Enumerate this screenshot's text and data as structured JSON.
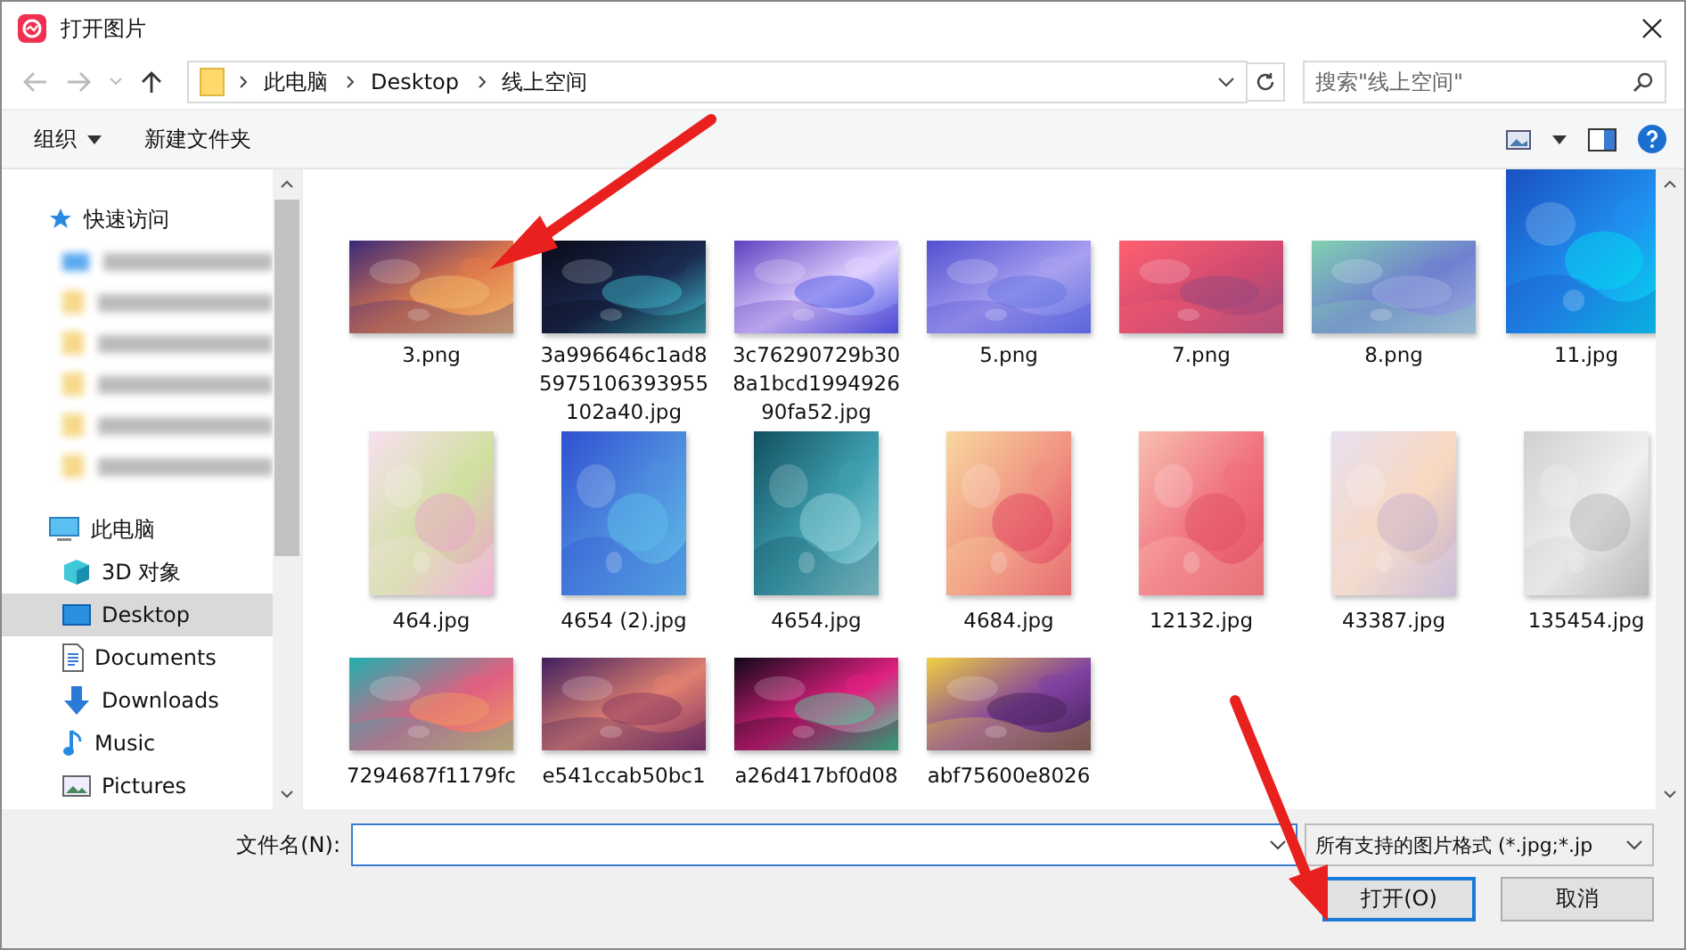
{
  "window": {
    "title": "打开图片"
  },
  "address": {
    "path": [
      "此电脑",
      "Desktop",
      "线上空间"
    ]
  },
  "search": {
    "placeholder": "搜索\"线上空间\""
  },
  "toolbar": {
    "buttons": [
      "组织",
      "新建文件夹"
    ]
  },
  "sidebar": {
    "quick_access": "快速访问",
    "items": [
      {
        "label": "此电脑",
        "kind": "pc",
        "selected": false,
        "children": [
          {
            "label": "3D 对象",
            "kind": "cube",
            "selected": false
          },
          {
            "label": "Desktop",
            "kind": "desktop",
            "selected": true
          },
          {
            "label": "Documents",
            "kind": "doc",
            "selected": false
          },
          {
            "label": "Downloads",
            "kind": "download",
            "selected": false
          },
          {
            "label": "Music",
            "kind": "music",
            "selected": false
          },
          {
            "label": "Pictures",
            "kind": "pictures",
            "selected": false
          }
        ]
      }
    ]
  },
  "files": [
    {
      "name": "3.png",
      "kind": "picture"
    },
    {
      "name": "3a996646c1ad85975106393955102a40.jpg",
      "kind": "picture"
    },
    {
      "name": "3c76290729b308a1bcd199492690fa52.jpg",
      "kind": "picture"
    },
    {
      "name": "5.png",
      "kind": "picture"
    },
    {
      "name": "7.png",
      "kind": "picture"
    },
    {
      "name": "8.png",
      "kind": "picture"
    },
    {
      "name": "11.jpg",
      "kind": "picture"
    },
    {
      "name": "464.jpg",
      "kind": "picture"
    },
    {
      "name": "4654 (2).jpg",
      "kind": "picture"
    },
    {
      "name": "4654.jpg",
      "kind": "picture"
    },
    {
      "name": "4684.jpg",
      "kind": "picture"
    },
    {
      "name": "12132.jpg",
      "kind": "picture"
    },
    {
      "name": "43387.jpg",
      "kind": "picture"
    },
    {
      "name": "135454.jpg",
      "kind": "picture"
    },
    {
      "name": "7294687f1179fc",
      "kind": "picture"
    },
    {
      "name": "e541ccab50bc1",
      "kind": "picture"
    },
    {
      "name": "a26d417bf0d08",
      "kind": "picture"
    },
    {
      "name": "abf75600e8026",
      "kind": "picture"
    }
  ],
  "footer": {
    "filename_label": "文件名(N):",
    "filter": "所有支持的图片格式 (*.jpg;*.jp",
    "buttons": [
      "打开(O)",
      "取消"
    ]
  }
}
